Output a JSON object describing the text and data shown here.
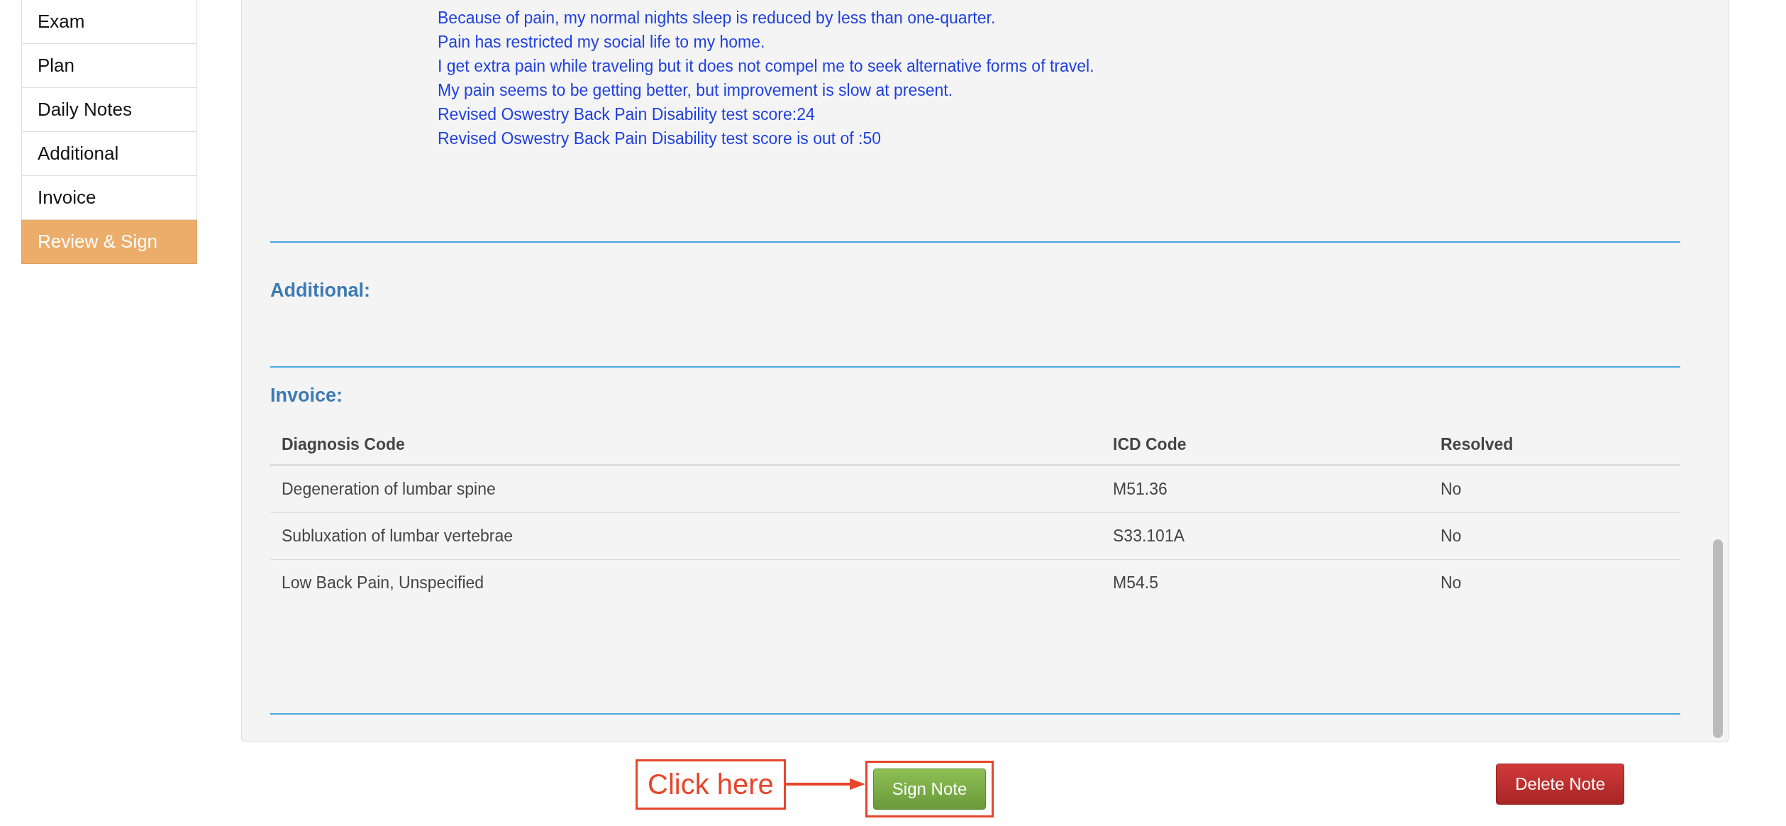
{
  "sidebar": {
    "items": [
      {
        "label": "Exam",
        "selected": false
      },
      {
        "label": "Plan",
        "selected": false
      },
      {
        "label": "Daily Notes",
        "selected": false
      },
      {
        "label": "Additional",
        "selected": false
      },
      {
        "label": "Invoice",
        "selected": false
      },
      {
        "label": "Review & Sign",
        "selected": true
      }
    ]
  },
  "review": {
    "answers": [
      "Because of pain, my normal nights sleep is reduced by less than one-quarter.",
      "Pain has restricted my social life to my home.",
      "I get extra pain while traveling but it does not compel me to seek alternative forms of travel.",
      "My pain seems to be getting better, but improvement is slow at present.",
      "Revised Oswestry Back Pain Disability test score:24",
      "Revised Oswestry Back Pain Disability test score is out of :50"
    ],
    "additional": {
      "heading": "Additional:"
    },
    "invoice": {
      "heading": "Invoice:",
      "columns": [
        "Diagnosis Code",
        "ICD Code",
        "Resolved"
      ],
      "rows": [
        [
          "Degeneration of lumbar spine",
          "M51.36",
          "No"
        ],
        [
          "Subluxation of lumbar vertebrae",
          "S33.101A",
          "No"
        ],
        [
          "Low Back Pain, Unspecified",
          "M54.5",
          "No"
        ]
      ]
    }
  },
  "annotation": {
    "label": "Click here"
  },
  "buttons": {
    "sign": "Sign Note",
    "delete": "Delete Note"
  }
}
